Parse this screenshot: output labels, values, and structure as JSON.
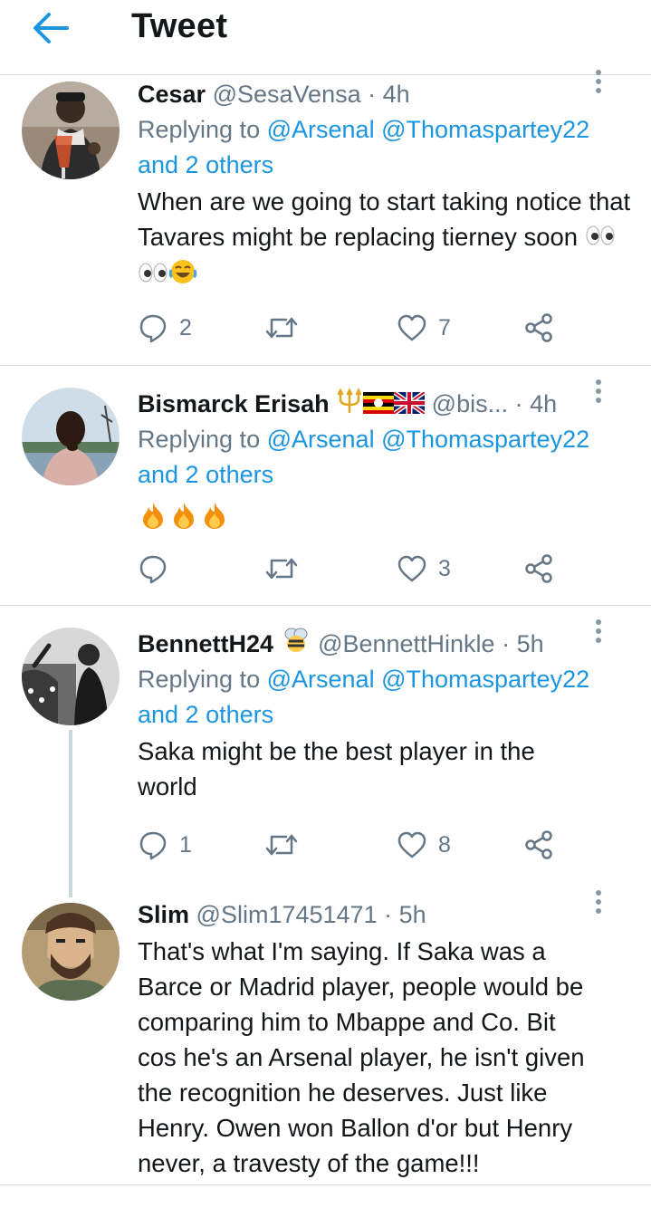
{
  "header": {
    "title": "Tweet"
  },
  "colors": {
    "accent": "#1b95e0",
    "muted": "#657786",
    "text": "#14171a",
    "divider": "#d7dbdf"
  },
  "tweets": [
    {
      "name": "Cesar",
      "handle": "@SesaVensa",
      "time": "· 4h",
      "replying_prefix": "Replying to",
      "mentions": [
        "@Arsenal",
        "@Thomaspartey22"
      ],
      "others": "and 2 others",
      "text": "When are we going to start taking notice that Tavares might be replacing tierney soon",
      "text_emoji": [
        "eyes",
        "eyes",
        "face-with-tears-of-joy"
      ],
      "replies": "2",
      "retweets": "",
      "likes": "7"
    },
    {
      "name": "Bismarck Erisah",
      "name_emoji": [
        "trident",
        "flag-uganda",
        "flag-uk"
      ],
      "handle": "@bis...",
      "time": "· 4h",
      "replying_prefix": "Replying to",
      "mentions": [
        "@Arsenal",
        "@Thomaspartey22"
      ],
      "others": "and 2 others",
      "text": "",
      "text_emoji": [
        "fire",
        "fire",
        "fire"
      ],
      "replies": "",
      "retweets": "",
      "likes": "3"
    },
    {
      "name": "BennettH24",
      "name_emoji": [
        "bee"
      ],
      "handle": "@BennettHinkle",
      "time": "· 5h",
      "replying_prefix": "Replying to",
      "mentions": [
        "@Arsenal",
        "@Thomaspartey22"
      ],
      "others": "and 2 others",
      "text_lines": [
        "Saka might be the best player in the",
        "world"
      ],
      "replies": "1",
      "retweets": "",
      "likes": "8"
    },
    {
      "name": "Slim",
      "handle": "@Slim17451471",
      "time": "· 5h",
      "text_lines": [
        "That's what I'm saying. If Saka was a",
        "Barce or Madrid player, people would be",
        "comparing him to Mbappe and Co. Bit",
        "cos he's an Arsenal player, he isn't given",
        "the recognition he deserves. Just like",
        "Henry. Owen won Ballon d'or but Henry",
        "never, a travesty of the game!!!"
      ]
    }
  ]
}
